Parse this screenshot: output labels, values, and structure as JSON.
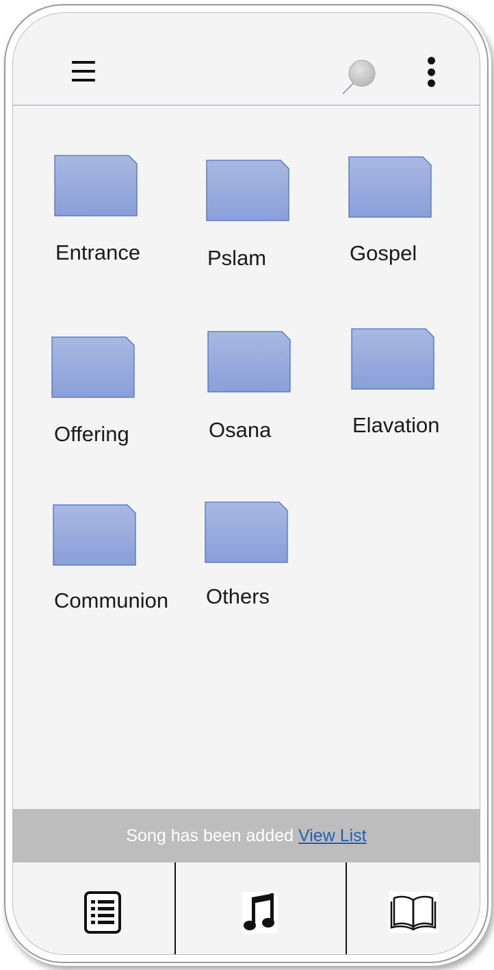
{
  "folders": [
    {
      "label": "Entrance"
    },
    {
      "label": "Pslam"
    },
    {
      "label": "Gospel"
    },
    {
      "label": "Offering"
    },
    {
      "label": "Osana"
    },
    {
      "label": "Elavation"
    },
    {
      "label": "Communion"
    },
    {
      "label": "Others"
    }
  ],
  "snackbar": {
    "message": "Song has been added",
    "action": "View List"
  },
  "icons": {
    "menu": "hamburger-menu-icon",
    "search": "search-icon",
    "more": "more-vertical-icon",
    "folder": "folder-icon",
    "list": "list-icon",
    "music": "music-note-icon",
    "book": "open-book-icon"
  },
  "colors": {
    "folder_fill": "#8fa5dc",
    "folder_stroke": "#4a72c4",
    "snackbar_bg": "#bdbdbd",
    "link": "#1f5fb3"
  }
}
